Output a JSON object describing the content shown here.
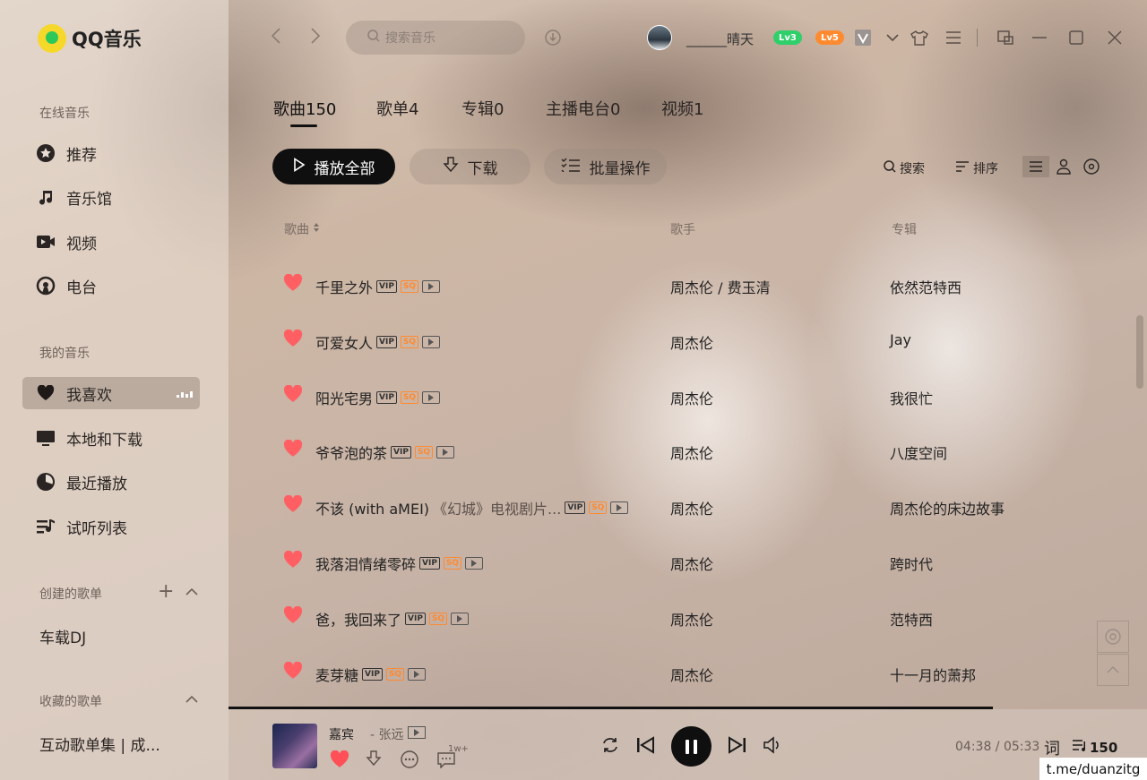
{
  "app": {
    "name": "QQ音乐"
  },
  "sidebar": {
    "section_online": "在线音乐",
    "online_items": [
      {
        "label": "推荐",
        "icon": "star-icon"
      },
      {
        "label": "音乐馆",
        "icon": "music-note-icon"
      },
      {
        "label": "视频",
        "icon": "video-icon"
      },
      {
        "label": "电台",
        "icon": "radio-icon"
      }
    ],
    "section_mine": "我的音乐",
    "mine_items": [
      {
        "label": "我喜欢",
        "icon": "heart-icon",
        "active": true
      },
      {
        "label": "本地和下载",
        "icon": "monitor-icon"
      },
      {
        "label": "最近播放",
        "icon": "clock-icon"
      },
      {
        "label": "试听列表",
        "icon": "playlist-icon"
      }
    ],
    "section_created": "创建的歌单",
    "created_playlists": [
      "车载DJ"
    ],
    "section_collected": "收藏的歌单",
    "collected_playlists": [
      "互动歌单集 | 成..."
    ]
  },
  "header": {
    "search_placeholder": "搜索音乐",
    "username": "______晴天",
    "badges": [
      {
        "text": "Lv3",
        "color": "#2fcf6a"
      },
      {
        "text": "Lv5",
        "color": "#ff8a30"
      }
    ]
  },
  "tabs": [
    {
      "label": "歌曲150",
      "active": true
    },
    {
      "label": "歌单4"
    },
    {
      "label": "专辑0"
    },
    {
      "label": "主播电台0"
    },
    {
      "label": "视频1"
    }
  ],
  "actions": {
    "play_all": "播放全部",
    "download": "下载",
    "batch": "批量操作",
    "search": "搜索",
    "sort": "排序"
  },
  "table": {
    "col_song": "歌曲",
    "col_artist": "歌手",
    "col_album": "专辑",
    "rows": [
      {
        "title": "千里之外",
        "subtitle": "",
        "artist": "周杰伦 / 费玉清",
        "album": "依然范特西"
      },
      {
        "title": "可爱女人",
        "subtitle": "",
        "artist": "周杰伦",
        "album": "Jay"
      },
      {
        "title": "阳光宅男",
        "subtitle": "",
        "artist": "周杰伦",
        "album": "我很忙"
      },
      {
        "title": "爷爷泡的茶",
        "subtitle": "",
        "artist": "周杰伦",
        "album": "八度空间"
      },
      {
        "title": "不该 (with aMEI)",
        "subtitle": "《幻城》电视剧片...",
        "artist": "周杰伦",
        "album": "周杰伦的床边故事"
      },
      {
        "title": "我落泪情绪零碎",
        "subtitle": "",
        "artist": "周杰伦",
        "album": "跨时代"
      },
      {
        "title": "爸，我回来了",
        "subtitle": "",
        "artist": "周杰伦",
        "album": "范特西"
      },
      {
        "title": "麦芽糖",
        "subtitle": "",
        "artist": "周杰伦",
        "album": "十一月的萧邦"
      }
    ],
    "tags": {
      "vip": "VIP",
      "sq": "SQ"
    }
  },
  "player": {
    "title": "嘉宾",
    "artist": "- 张远",
    "comments": "1w+",
    "time": "04:38 / 05:33",
    "lyric_label": "词",
    "queue_count": "150"
  },
  "watermark": "t.me/duanzitg"
}
